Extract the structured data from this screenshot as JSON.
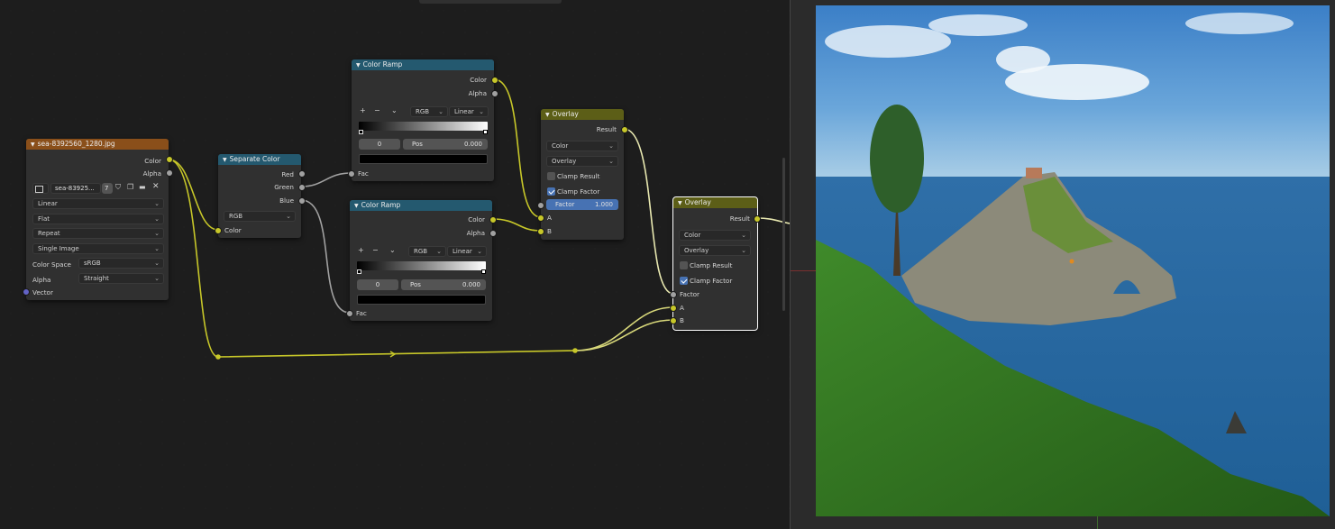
{
  "image_node": {
    "title": "sea-8392560_1280.jpg",
    "out_color": "Color",
    "out_alpha": "Alpha",
    "image_name": "sea-83925...",
    "users": "7",
    "interpolation": "Linear",
    "projection": "Flat",
    "extension": "Repeat",
    "source": "Single Image",
    "color_space_label": "Color Space",
    "color_space": "sRGB",
    "alpha_label": "Alpha",
    "alpha_mode": "Straight",
    "in_vector": "Vector"
  },
  "separate_color": {
    "title": "Separate Color",
    "out_red": "Red",
    "out_green": "Green",
    "out_blue": "Blue",
    "mode": "RGB",
    "in_color": "Color"
  },
  "ramp1": {
    "title": "Color Ramp",
    "out_color": "Color",
    "out_alpha": "Alpha",
    "color_mode": "RGB",
    "interp": "Linear",
    "index": "0",
    "pos_label": "Pos",
    "pos_value": "0.000",
    "in_fac": "Fac"
  },
  "ramp2": {
    "title": "Color Ramp",
    "out_color": "Color",
    "out_alpha": "Alpha",
    "color_mode": "RGB",
    "interp": "Linear",
    "index": "0",
    "pos_label": "Pos",
    "pos_value": "0.000",
    "in_fac": "Fac"
  },
  "overlay1": {
    "title": "Overlay",
    "out_result": "Result",
    "data_type": "Color",
    "blend": "Overlay",
    "clamp_result": "Clamp Result",
    "clamp_factor": "Clamp Factor",
    "factor_label": "Factor",
    "factor_value": "1.000",
    "in_a": "A",
    "in_b": "B"
  },
  "overlay2": {
    "title": "Overlay",
    "out_result": "Result",
    "data_type": "Color",
    "blend": "Overlay",
    "clamp_result": "Clamp Result",
    "clamp_factor": "Clamp Factor",
    "in_factor": "Factor",
    "in_a": "A",
    "in_b": "B"
  },
  "colors": {
    "image_header": "#8a4f1a",
    "converter_header": "#24596f",
    "mix_header": "#5c5e17",
    "color_socket": "#c7c729",
    "float_socket": "#a1a1a1",
    "vector_socket": "#6363c7",
    "accent": "#4772b3"
  }
}
